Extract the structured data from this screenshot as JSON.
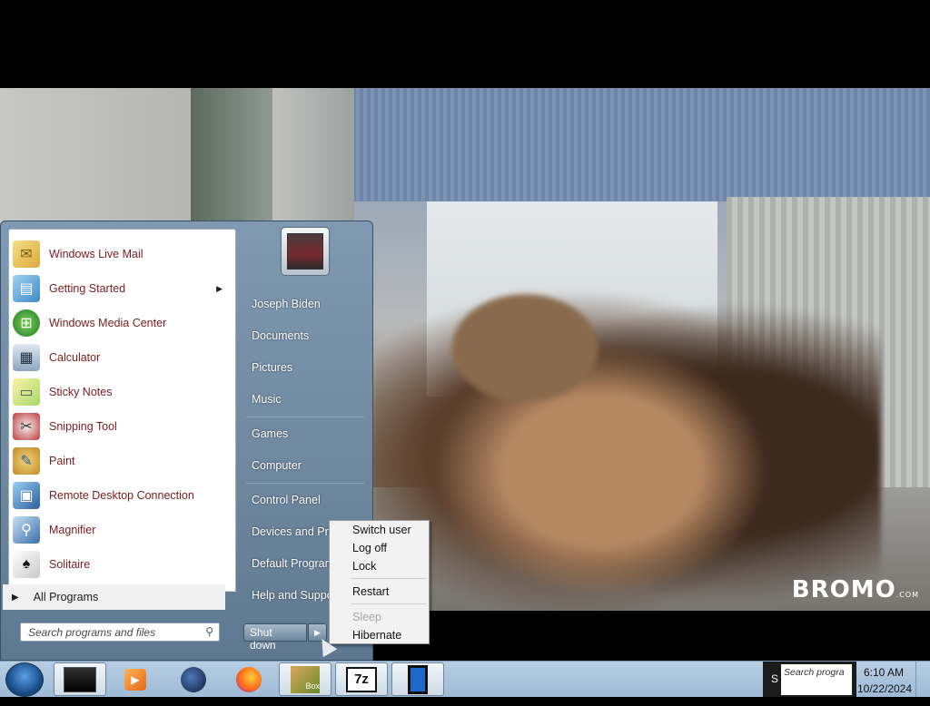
{
  "start_menu": {
    "programs": [
      {
        "label": "Windows Live Mail",
        "icon": "mail-icon"
      },
      {
        "label": "Getting Started",
        "icon": "getting-started-icon",
        "has_submenu": true
      },
      {
        "label": "Windows Media Center",
        "icon": "media-center-icon"
      },
      {
        "label": "Calculator",
        "icon": "calculator-icon"
      },
      {
        "label": "Sticky Notes",
        "icon": "sticky-notes-icon"
      },
      {
        "label": "Snipping Tool",
        "icon": "snipping-tool-icon"
      },
      {
        "label": "Paint",
        "icon": "paint-icon"
      },
      {
        "label": "Remote Desktop Connection",
        "icon": "remote-desktop-icon"
      },
      {
        "label": "Magnifier",
        "icon": "magnifier-icon"
      },
      {
        "label": "Solitaire",
        "icon": "solitaire-icon"
      }
    ],
    "all_programs": "All Programs",
    "search_placeholder": "Search programs and files",
    "right_items": {
      "user": "Joseph Biden",
      "documents": "Documents",
      "pictures": "Pictures",
      "music": "Music",
      "games": "Games",
      "computer": "Computer",
      "control_panel": "Control Panel",
      "devices": "Devices and Prin",
      "default_programs": "Default Program",
      "help": "Help and Suppo"
    },
    "shutdown_label": "Shut down"
  },
  "power_menu": {
    "switch_user": "Switch user",
    "log_off": "Log off",
    "lock": "Lock",
    "restart": "Restart",
    "sleep": "Sleep",
    "hibernate": "Hibernate"
  },
  "video": {
    "watermark": "BROMO",
    "watermark_suffix": ".COM"
  },
  "taskbar": {
    "tray_search": "Search progra",
    "tray_s": "S",
    "time": "6:10 AM",
    "date": "10/22/2024",
    "sevenzip_label": "7z",
    "box_label": "Box"
  }
}
